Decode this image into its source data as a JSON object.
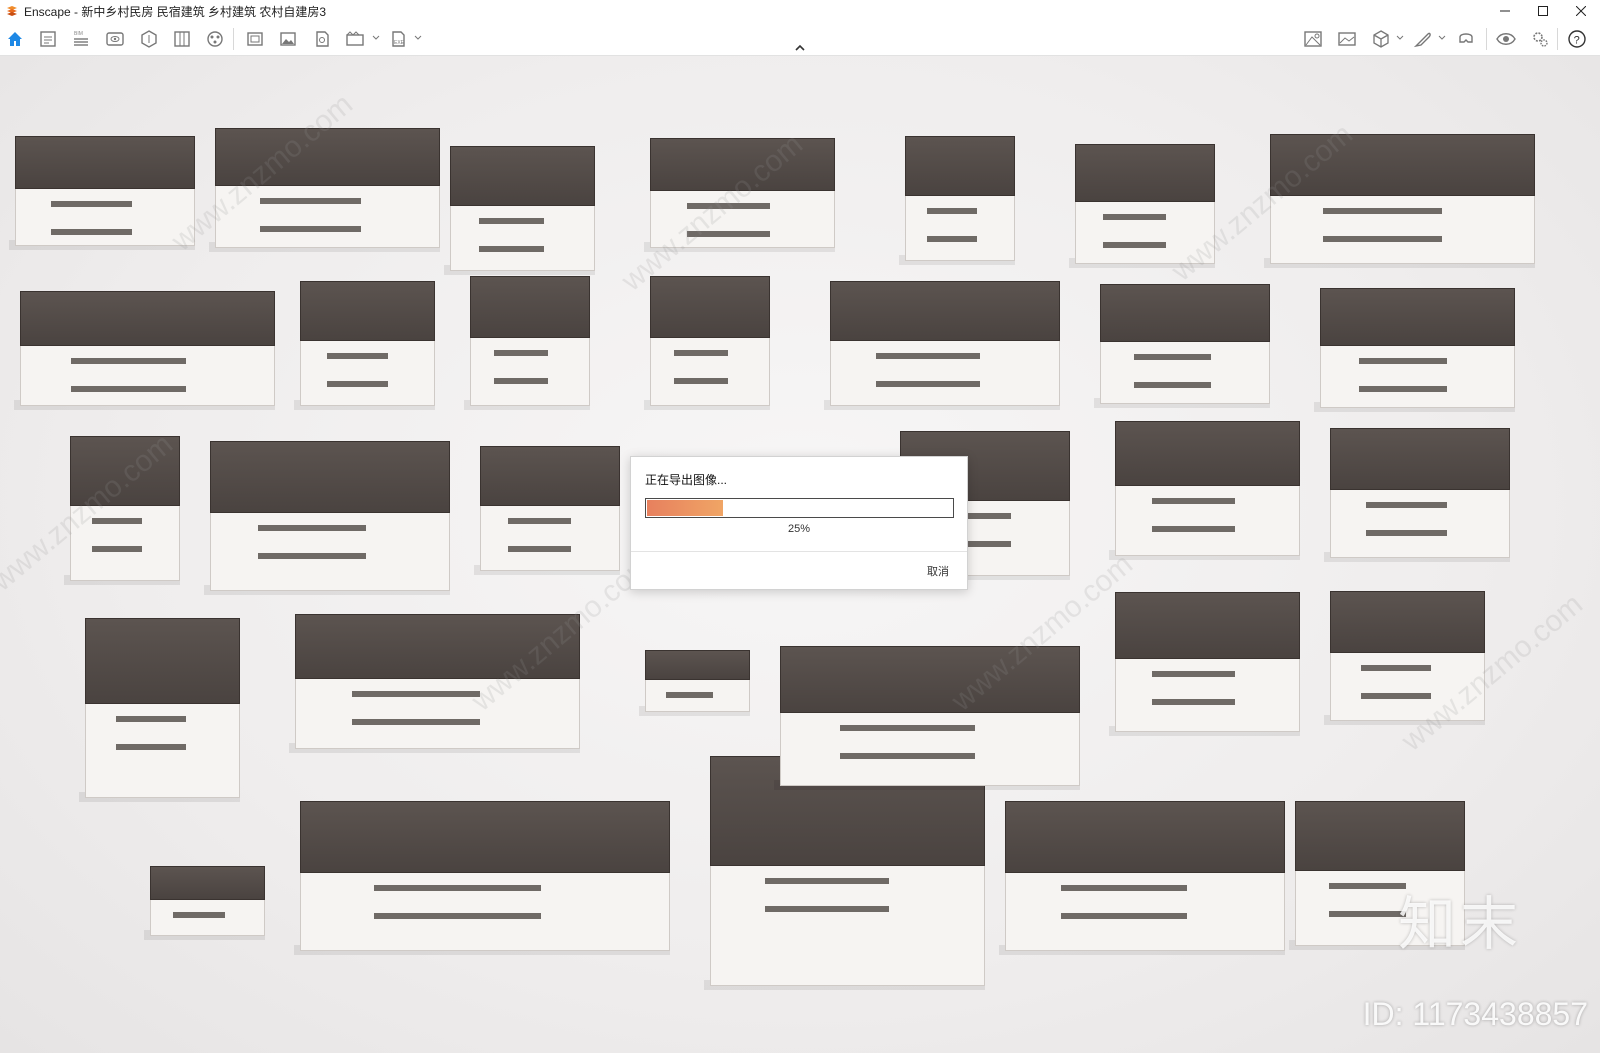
{
  "window": {
    "title": "Enscape - 新中乡村民房 民宿建筑 乡村建筑 农村自建房3"
  },
  "toolbar": {
    "left_icons": [
      "home-icon",
      "document-icon",
      "bim-icon",
      "eye-view-icon",
      "sun-icon",
      "library-icon",
      "asset-icon",
      "capture-icon",
      "image-icon",
      "batch-render-icon",
      "video-icon",
      "exe-export-icon"
    ],
    "right_icons": [
      "settings-view-icon",
      "screenshot-icon",
      "cube-icon",
      "feather-icon",
      "vr-icon",
      "visibility-icon",
      "gears-icon",
      "help-icon"
    ]
  },
  "dialog": {
    "title": "正在导出图像...",
    "progress_percent": 25,
    "progress_label": "25%",
    "cancel_label": "取消"
  },
  "watermark": {
    "brand": "知末",
    "id_text": "ID: 1173438857",
    "diagonal_text": "www.znzmo.com"
  },
  "colors": {
    "progress_start": "#e7805e",
    "progress_end": "#f0a565",
    "roof": "#4f4744",
    "wall": "#f6f4f2",
    "accent_home": "#1e88e5"
  }
}
